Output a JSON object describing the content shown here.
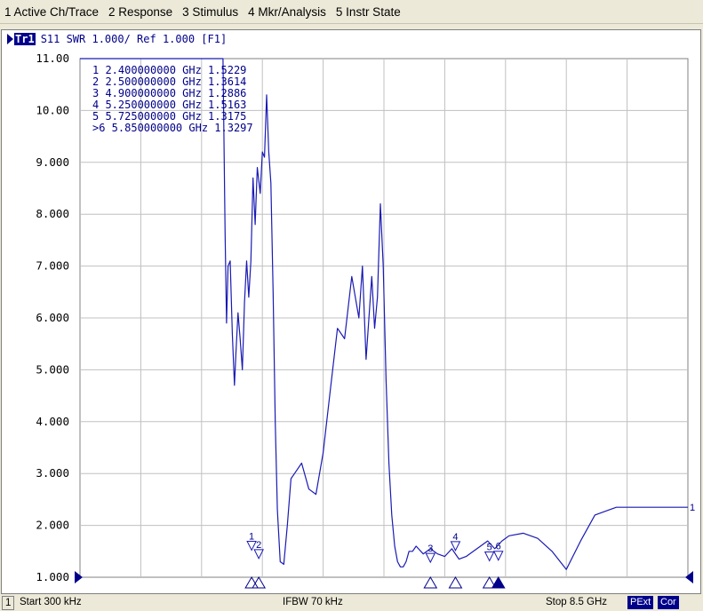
{
  "menu": [
    "1 Active Ch/Trace",
    "2 Response",
    "3 Stimulus",
    "4 Mkr/Analysis",
    "5 Instr State"
  ],
  "trace": {
    "tag": "Tr1",
    "status": "S11  SWR 1.000/ Ref 1.000 [F1]"
  },
  "status_bar": {
    "channel": "1",
    "start": "Start 300 kHz",
    "ifbw": "IFBW 70 kHz",
    "stop": "Stop 8.5 GHz",
    "badges": [
      "PExt",
      "Cor"
    ]
  },
  "colors": {
    "trace": "#1a1ab4",
    "grid": "#c0c0c0",
    "text": "#00008b",
    "background": "#ece9d8"
  },
  "chart_data": {
    "type": "line",
    "xlabel": "",
    "ylabel": "",
    "x_unit": "GHz",
    "xlim": [
      0.0003,
      8.5
    ],
    "ylim": [
      1.0,
      11.0
    ],
    "grid": true,
    "y_ticks": [
      "11.00",
      "10.00",
      "9.000",
      "8.000",
      "7.000",
      "6.000",
      "5.000",
      "4.000",
      "3.000",
      "2.000",
      "1.000"
    ],
    "series": [
      {
        "x": [
          0.0003,
          2.0,
          2.03,
          2.05,
          2.07,
          2.1,
          2.13,
          2.16,
          2.18,
          2.21,
          2.24,
          2.27,
          2.3,
          2.33,
          2.36,
          2.39,
          2.42,
          2.45,
          2.48,
          2.52,
          2.55,
          2.58,
          2.61,
          2.64,
          2.67,
          2.7,
          2.73,
          2.76,
          2.8,
          2.85,
          2.9,
          2.95,
          3.0,
          3.1,
          3.2,
          3.3,
          3.4,
          3.5,
          3.6,
          3.7,
          3.8,
          3.9,
          3.95,
          4.0,
          4.04,
          4.08,
          4.12,
          4.16,
          4.2,
          4.24,
          4.28,
          4.32,
          4.36,
          4.4,
          4.44,
          4.48,
          4.52,
          4.56,
          4.6,
          4.65,
          4.7,
          4.8,
          4.9,
          5.0,
          5.1,
          5.2,
          5.3,
          5.4,
          5.5,
          5.6,
          5.7,
          5.8,
          5.9,
          6.0,
          6.2,
          6.4,
          6.6,
          6.8,
          7.0,
          7.2,
          7.4,
          7.5,
          7.6,
          7.7,
          7.8,
          7.9,
          8.0,
          8.2,
          8.5
        ],
        "y": [
          11.0,
          11.0,
          7.6,
          5.9,
          7.0,
          7.1,
          5.7,
          4.7,
          5.3,
          6.1,
          5.6,
          5.0,
          6.3,
          7.1,
          6.4,
          7.1,
          8.7,
          7.8,
          8.9,
          8.4,
          9.2,
          9.1,
          10.3,
          9.2,
          8.6,
          6.5,
          4.0,
          2.3,
          1.3,
          1.25,
          2.0,
          2.9,
          3.0,
          3.2,
          2.7,
          2.6,
          3.4,
          4.6,
          5.8,
          5.6,
          6.8,
          6.0,
          7.0,
          5.2,
          6.0,
          6.8,
          5.8,
          6.4,
          8.2,
          7.0,
          4.8,
          3.2,
          2.2,
          1.6,
          1.3,
          1.2,
          1.2,
          1.3,
          1.5,
          1.5,
          1.6,
          1.45,
          1.55,
          1.45,
          1.4,
          1.55,
          1.35,
          1.4,
          1.5,
          1.6,
          1.7,
          1.55,
          1.7,
          1.8,
          1.85,
          1.75,
          1.5,
          1.15,
          1.7,
          2.2,
          2.3,
          2.35,
          2.35,
          2.35,
          2.35,
          2.35,
          2.35,
          2.35,
          2.35
        ]
      }
    ],
    "end_label": "1",
    "markers": [
      {
        "id": "1",
        "x": 2.4,
        "y": 1.5229,
        "label": "1   2.400000000 GHz  1.5229"
      },
      {
        "id": "2",
        "x": 2.5,
        "y": 1.3614,
        "label": "2   2.500000000 GHz  1.3614"
      },
      {
        "id": "3",
        "x": 4.9,
        "y": 1.2886,
        "label": "3   4.900000000 GHz  1.2886"
      },
      {
        "id": "4",
        "x": 5.25,
        "y": 1.5163,
        "label": "4   5.250000000 GHz  1.5163"
      },
      {
        "id": "5",
        "x": 5.725,
        "y": 1.3175,
        "label": "5   5.725000000 GHz  1.3175"
      },
      {
        "id": "6",
        "x": 5.85,
        "y": 1.3297,
        "label": ">6  5.850000000 GHz  1.3297",
        "active": true
      }
    ]
  }
}
